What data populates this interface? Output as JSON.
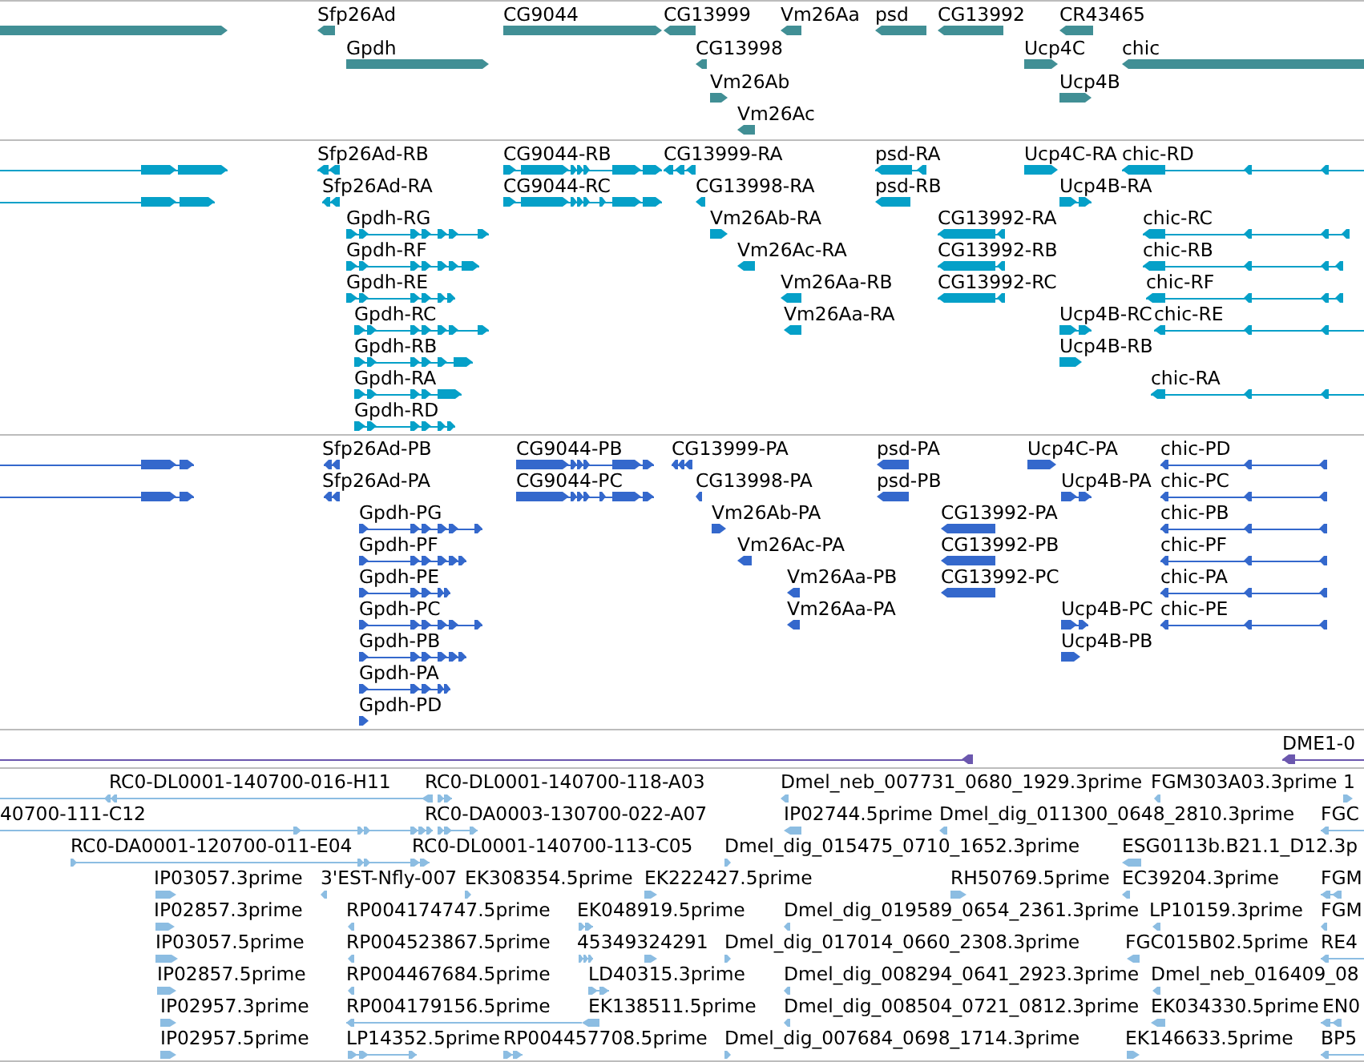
{
  "tracks": [
    {
      "kind": "gene",
      "rows": [
        {
          "features": [
            {
              "minus_strand": false
            },
            {
              "label": "Sfp26Ad",
              "minus_strand": true
            },
            {
              "label": "CG9044",
              "minus_strand": false
            },
            {
              "label": "CG13999",
              "minus_strand": true
            },
            {
              "label": "Vm26Aa",
              "minus_strand": true
            },
            {
              "label": "psd",
              "minus_strand": true
            },
            {
              "label": "CG13992",
              "minus_strand": true
            },
            {
              "label": "CR43465",
              "minus_strand": true
            }
          ]
        },
        {
          "features": [
            {
              "label": "Gpdh",
              "minus_strand": false
            },
            {
              "label": "CG13998",
              "minus_strand": true
            },
            {
              "label": "Ucp4C",
              "minus_strand": false
            },
            {
              "label": "chic",
              "minus_strand": true
            }
          ]
        },
        {
          "features": [
            {
              "label": "Vm26Ab",
              "minus_strand": false
            },
            {
              "label": "Ucp4B",
              "minus_strand": false
            }
          ]
        },
        {
          "features": [
            {
              "label": "Vm26Ac",
              "minus_strand": true
            }
          ]
        }
      ]
    },
    {
      "kind": "transcript",
      "rows": [
        {
          "features": [
            {
              "minus_strand": false
            },
            {
              "label": "Sfp26Ad-RB",
              "minus_strand": true
            },
            {
              "label": "CG9044-RB",
              "minus_strand": false
            },
            {
              "label": "CG13999-RA",
              "minus_strand": true
            },
            {
              "label": "psd-RA",
              "minus_strand": true
            },
            {
              "label": "Ucp4C-RA",
              "minus_strand": false
            },
            {
              "label": "chic-RD",
              "minus_strand": true
            }
          ]
        },
        {
          "features": [
            {
              "minus_strand": false
            },
            {
              "label": "Sfp26Ad-RA",
              "minus_strand": true
            },
            {
              "label": "CG9044-RC",
              "minus_strand": false
            },
            {
              "label": "CG13998-RA",
              "minus_strand": true
            },
            {
              "label": "psd-RB",
              "minus_strand": true
            },
            {
              "label": "Ucp4B-RA",
              "minus_strand": false
            }
          ]
        },
        {
          "features": [
            {
              "label": "Gpdh-RG",
              "minus_strand": false
            },
            {
              "label": "Vm26Ab-RA",
              "minus_strand": false
            },
            {
              "label": "CG13992-RA",
              "minus_strand": true
            },
            {
              "label": "chic-RC",
              "minus_strand": true
            }
          ]
        },
        {
          "features": [
            {
              "label": "Gpdh-RF",
              "minus_strand": false
            },
            {
              "label": "Vm26Ac-RA",
              "minus_strand": true
            },
            {
              "label": "CG13992-RB",
              "minus_strand": true
            },
            {
              "label": "chic-RB",
              "minus_strand": true
            }
          ]
        },
        {
          "features": [
            {
              "label": "Gpdh-RE",
              "minus_strand": false
            },
            {
              "label": "Vm26Aa-RB",
              "minus_strand": true
            },
            {
              "label": "CG13992-RC",
              "minus_strand": true
            },
            {
              "label": "chic-RF",
              "minus_strand": true
            }
          ]
        },
        {
          "features": [
            {
              "label": "Gpdh-RC",
              "minus_strand": false
            },
            {
              "label": "Vm26Aa-RA",
              "minus_strand": true
            },
            {
              "label": "Ucp4B-RC",
              "minus_strand": false
            },
            {
              "label": "chic-RE",
              "minus_strand": true
            }
          ]
        },
        {
          "features": [
            {
              "label": "Gpdh-RB",
              "minus_strand": false
            },
            {
              "label": "Ucp4B-RB",
              "minus_strand": false
            }
          ]
        },
        {
          "features": [
            {
              "label": "Gpdh-RA",
              "minus_strand": false
            },
            {
              "label": "chic-RA",
              "minus_strand": true
            }
          ]
        },
        {
          "features": [
            {
              "label": "Gpdh-RD",
              "minus_strand": false
            }
          ]
        }
      ]
    },
    {
      "kind": "protein",
      "rows": [
        {
          "features": [
            {
              "minus_strand": false
            },
            {
              "label": "Sfp26Ad-PB",
              "minus_strand": true
            },
            {
              "label": "CG9044-PB",
              "minus_strand": false
            },
            {
              "label": "CG13999-PA",
              "minus_strand": true
            },
            {
              "label": "psd-PA",
              "minus_strand": true
            },
            {
              "label": "Ucp4C-PA",
              "minus_strand": false
            },
            {
              "label": "chic-PD",
              "minus_strand": true
            }
          ]
        },
        {
          "features": [
            {
              "minus_strand": false
            },
            {
              "label": "Sfp26Ad-PA",
              "minus_strand": true
            },
            {
              "label": "CG9044-PC",
              "minus_strand": false
            },
            {
              "label": "CG13998-PA",
              "minus_strand": true
            },
            {
              "label": "psd-PB",
              "minus_strand": true
            },
            {
              "label": "Ucp4B-PA",
              "minus_strand": false
            },
            {
              "label": "chic-PC",
              "minus_strand": true
            }
          ]
        },
        {
          "features": [
            {
              "label": "Gpdh-PG",
              "minus_strand": false
            },
            {
              "label": "Vm26Ab-PA",
              "minus_strand": false
            },
            {
              "label": "CG13992-PA",
              "minus_strand": true
            },
            {
              "label": "chic-PB",
              "minus_strand": true
            }
          ]
        },
        {
          "features": [
            {
              "label": "Gpdh-PF",
              "minus_strand": false
            },
            {
              "label": "Vm26Ac-PA",
              "minus_strand": true
            },
            {
              "label": "CG13992-PB",
              "minus_strand": true
            },
            {
              "label": "chic-PF",
              "minus_strand": true
            }
          ]
        },
        {
          "features": [
            {
              "label": "Gpdh-PE",
              "minus_strand": false
            },
            {
              "label": "Vm26Aa-PB",
              "minus_strand": true
            },
            {
              "label": "CG13992-PC",
              "minus_strand": true
            },
            {
              "label": "chic-PA",
              "minus_strand": true
            }
          ]
        },
        {
          "features": [
            {
              "label": "Gpdh-PC",
              "minus_strand": false
            },
            {
              "label": "Vm26Aa-PA",
              "minus_strand": true
            },
            {
              "label": "Ucp4B-PC",
              "minus_strand": false
            },
            {
              "label": "chic-PE",
              "minus_strand": true
            }
          ]
        },
        {
          "features": [
            {
              "label": "Gpdh-PB",
              "minus_strand": false
            },
            {
              "label": "Ucp4B-PB",
              "minus_strand": false
            }
          ]
        },
        {
          "features": [
            {
              "label": "Gpdh-PA",
              "minus_strand": false
            }
          ]
        },
        {
          "features": [
            {
              "label": "Gpdh-PD",
              "minus_strand": false
            }
          ]
        }
      ]
    },
    {
      "kind": "alignment",
      "rows": [
        {
          "features": [
            {
              "minus_strand": true
            },
            {
              "label": "DME1-0",
              "minus_strand": true
            }
          ]
        }
      ]
    },
    {
      "kind": "est",
      "rows": [
        {
          "features": [
            {
              "label": "RC0-DL0001-140700-016-H11",
              "minus_strand": true
            },
            {
              "label": "RC0-DL0001-140700-118-A03",
              "minus_strand": false
            },
            {
              "label": "Dmel_neb_007731_0680_1929.3prime",
              "minus_strand": true
            },
            {
              "label": "FGM303A03.3prime",
              "minus_strand": true
            },
            {
              "label": "1",
              "minus_strand": false
            }
          ]
        },
        {
          "features": [
            {
              "label": "40700-111-C12",
              "minus_strand": false
            },
            {
              "label": "RC0-DA0003-130700-022-A07",
              "minus_strand": false
            },
            {
              "label": "IP02744.5prime",
              "minus_strand": true
            },
            {
              "label": "Dmel_dig_011300_0648_2810.3prime",
              "minus_strand": true
            },
            {
              "label": "FGC",
              "minus_strand": true
            }
          ]
        },
        {
          "features": [
            {
              "label": "RC0-DA0001-120700-011-E04",
              "minus_strand": false
            },
            {
              "label": "RC0-DL0001-140700-113-C05",
              "minus_strand": false
            },
            {
              "label": "Dmel_dig_015475_0710_1652.3prime",
              "minus_strand": false
            },
            {
              "label": "ESG0113b.B21.1_D12.3p",
              "minus_strand": true
            }
          ]
        },
        {
          "features": [
            {
              "label": "IP03057.3prime",
              "minus_strand": false
            },
            {
              "label": "3'EST-Nfly-007",
              "minus_strand": true
            },
            {
              "label": "EK308354.5prime",
              "minus_strand": false
            },
            {
              "label": "EK222427.5prime",
              "minus_strand": false
            },
            {
              "label": "RH50769.5prime",
              "minus_strand": false
            },
            {
              "label": "EC39204.3prime",
              "minus_strand": true
            },
            {
              "label": "FGM",
              "minus_strand": true
            }
          ]
        },
        {
          "features": [
            {
              "label": "IP02857.3prime",
              "minus_strand": false
            },
            {
              "label": "RP004174747.5prime",
              "minus_strand": true
            },
            {
              "label": "EK048919.5prime",
              "minus_strand": false
            },
            {
              "label": "Dmel_dig_019589_0654_2361.3prime",
              "minus_strand": true
            },
            {
              "label": "LP10159.3prime",
              "minus_strand": true
            },
            {
              "label": "FGM",
              "minus_strand": true
            }
          ]
        },
        {
          "features": [
            {
              "label": "IP03057.5prime",
              "minus_strand": false
            },
            {
              "label": "RP004523867.5prime",
              "minus_strand": true
            },
            {
              "label": "45349324291",
              "minus_strand": false
            },
            {
              "minus_strand": false
            },
            {
              "label": "Dmel_dig_017014_0660_2308.3prime",
              "minus_strand": false
            },
            {
              "label": "FGC015B02.5prime",
              "minus_strand": true
            },
            {
              "label": "RE4",
              "minus_strand": true
            }
          ]
        },
        {
          "features": [
            {
              "label": "IP02857.5prime",
              "minus_strand": false
            },
            {
              "label": "RP004467684.5prime",
              "minus_strand": true
            },
            {
              "label": "LD40315.3prime",
              "minus_strand": false
            },
            {
              "label": "Dmel_dig_008294_0641_2923.3prime",
              "minus_strand": true
            },
            {
              "label": "Dmel_neb_016409_08",
              "minus_strand": true
            }
          ]
        },
        {
          "features": [
            {
              "label": "IP02957.3prime",
              "minus_strand": false
            },
            {
              "label": "RP004179156.5prime",
              "minus_strand": true
            },
            {
              "label": "EK138511.5prime",
              "minus_strand": true
            },
            {
              "label": "Dmel_dig_008504_0721_0812.3prime",
              "minus_strand": true
            },
            {
              "label": "EK034330.5prime",
              "minus_strand": true
            },
            {
              "label": "EN0",
              "minus_strand": true
            }
          ]
        },
        {
          "features": [
            {
              "label": "IP02957.5prime",
              "minus_strand": false
            },
            {
              "label": "LP14352.5prime",
              "minus_strand": false
            },
            {
              "label": "RP004457708.5prime",
              "minus_strand": false
            },
            {
              "label": "Dmel_dig_007684_0698_1714.3prime",
              "minus_strand": false
            },
            {
              "label": "EK146633.5prime",
              "minus_strand": false
            },
            {
              "label": "BP5",
              "minus_strand": true
            }
          ]
        }
      ]
    }
  ]
}
